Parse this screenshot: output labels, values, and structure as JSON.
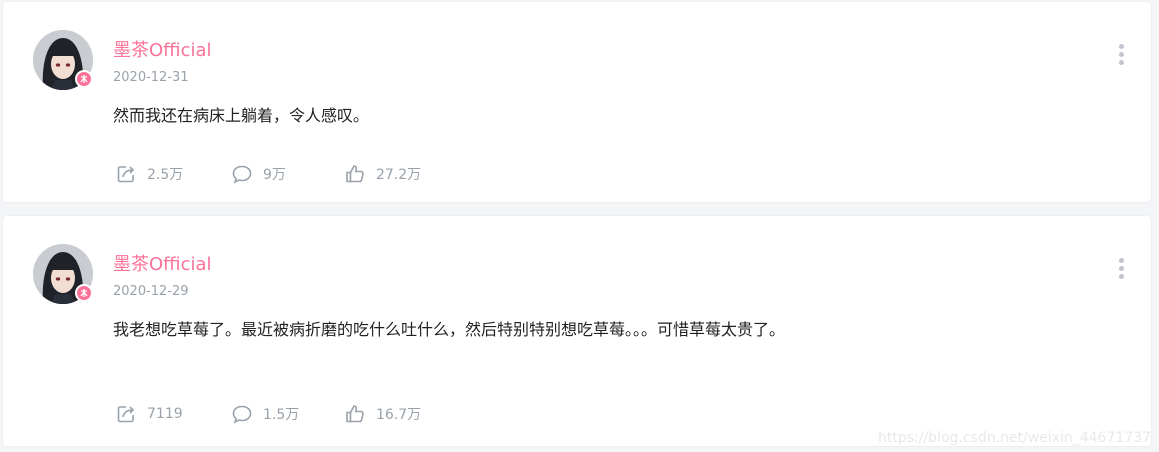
{
  "posts": [
    {
      "author": "墨茶Official",
      "date": "2020-12-31",
      "text": "然而我还在病床上躺着，令人感叹。",
      "shares": "2.5万",
      "comments": "9万",
      "likes": "27.2万"
    },
    {
      "author": "墨茶Official",
      "date": "2020-12-29",
      "text": "我老想吃草莓了。最近被病折磨的吃什么吐什么，然后特别特别想吃草莓。。。可惜草莓太贵了。",
      "shares": "7119",
      "comments": "1.5万",
      "likes": "16.7万"
    }
  ],
  "watermark": "https://blog.csdn.net/weixin_44671737",
  "colors": {
    "accent": "#fb7299",
    "muted": "#99a2aa",
    "background": "#f4f5f7"
  },
  "icons": [
    "share-icon",
    "comment-icon",
    "thumbs-up-icon",
    "more-vertical-icon"
  ]
}
